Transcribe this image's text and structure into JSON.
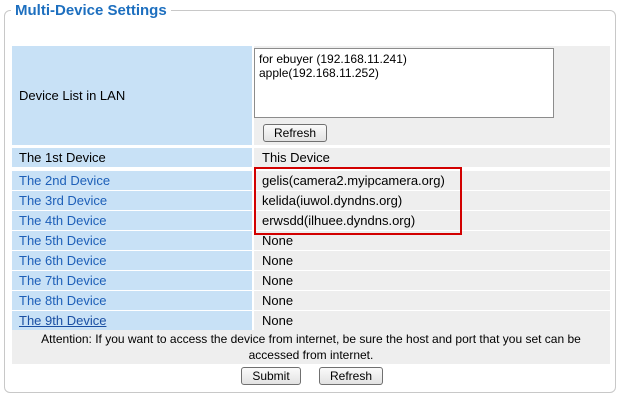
{
  "panel": {
    "title": "Multi-Device Settings"
  },
  "device_list": {
    "label": "Device List in LAN",
    "items": [
      "for ebuyer (192.168.11.241)",
      "apple(192.168.11.252)"
    ],
    "refresh_label": "Refresh"
  },
  "devices": [
    {
      "label": "The 1st Device",
      "value": "This Device"
    },
    {
      "label": "The 2nd Device",
      "value": "gelis(camera2.myipcamera.org)"
    },
    {
      "label": "The 3rd Device",
      "value": "kelida(iuwol.dyndns.org)"
    },
    {
      "label": "The 4th Device",
      "value": "erwsdd(ilhuee.dyndns.org)"
    },
    {
      "label": "The 5th Device",
      "value": "None"
    },
    {
      "label": "The 6th Device",
      "value": "None"
    },
    {
      "label": "The 7th Device",
      "value": "None"
    },
    {
      "label": "The 8th Device",
      "value": "None"
    },
    {
      "label": "The 9th Device",
      "value": "None"
    }
  ],
  "attention": {
    "line1": "Attention: If you want to access the device from internet, be sure the host and port that you set can be",
    "line2": "accessed from internet."
  },
  "footer": {
    "submit_label": "Submit",
    "refresh_label": "Refresh"
  },
  "colors": {
    "title": "#1d6fbf",
    "label_bg": "#c8e1f6",
    "value_bg": "#eeeeee",
    "highlight": "#d20000"
  }
}
